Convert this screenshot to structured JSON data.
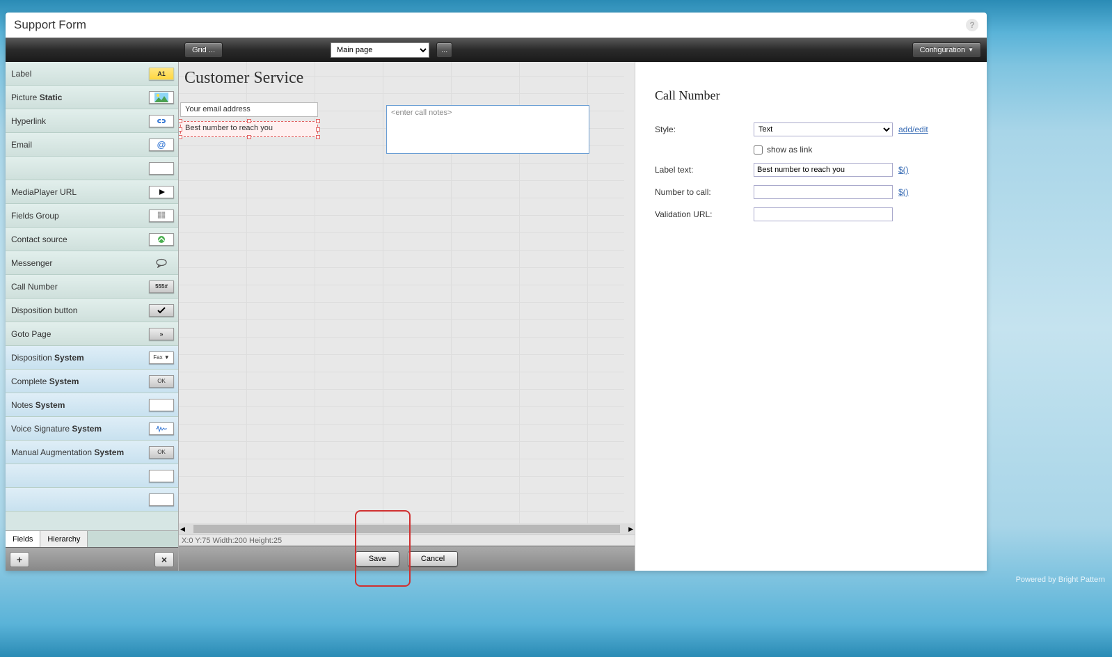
{
  "header": {
    "title": "Support Form"
  },
  "toolbar": {
    "grid_label": "Grid ...",
    "page_selected": "Main page",
    "ellipsis_label": "...",
    "config_label": "Configuration"
  },
  "palette": {
    "items": [
      {
        "label": "Label",
        "chip": "A1",
        "style": "default"
      },
      {
        "label_prefix": "Picture ",
        "label_bold": "Static",
        "chip": "img",
        "style": "default"
      },
      {
        "label": "Hyperlink",
        "chip": "link",
        "style": "default"
      },
      {
        "label": "Email",
        "chip": "@",
        "style": "default"
      },
      {
        "label": "",
        "chip": "",
        "style": "empty"
      },
      {
        "label": "MediaPlayer URL",
        "chip": "play",
        "style": "default"
      },
      {
        "label": "Fields Group",
        "chip": "grid",
        "style": "default"
      },
      {
        "label": "Contact source",
        "chip": "contact",
        "style": "default"
      },
      {
        "label": "Messenger",
        "chip": "chat",
        "style": "default"
      },
      {
        "label": "Call Number",
        "chip": "555#",
        "style": "default"
      },
      {
        "label": "Disposition button",
        "chip": "check",
        "style": "default"
      },
      {
        "label": "Goto Page",
        "chip": ">>",
        "style": "default"
      },
      {
        "label_prefix": "Disposition ",
        "label_bold": "System",
        "chip": "Fax ▼",
        "style": "blue"
      },
      {
        "label_prefix": "Complete ",
        "label_bold": "System",
        "chip": "OK",
        "style": "blue"
      },
      {
        "label_prefix": "Notes ",
        "label_bold": "System",
        "chip": "",
        "style": "blue"
      },
      {
        "label_prefix": "Voice Signature ",
        "label_bold": "System",
        "chip": "wave",
        "style": "blue"
      },
      {
        "label_prefix": "Manual Augmentation ",
        "label_bold": "System",
        "chip": "OK",
        "style": "blue"
      },
      {
        "label": "",
        "chip": "",
        "style": "blue"
      },
      {
        "label": "",
        "chip": "",
        "style": "blue"
      }
    ],
    "tabs": {
      "fields": "Fields",
      "hierarchy": "Hierarchy"
    }
  },
  "canvas": {
    "title": "Customer Service",
    "email_field_label": "Your email address",
    "callnum_field_label": "Best number to reach you",
    "notes_placeholder": "<enter call notes>",
    "status": "X:0 Y:75 Width:200 Height:25"
  },
  "actions": {
    "save": "Save",
    "cancel": "Cancel"
  },
  "props": {
    "title": "Call Number",
    "rows": {
      "style_label": "Style:",
      "style_value": "Text",
      "addedit_link": "add/edit",
      "showlink_label": "show as link",
      "showlink_checked": false,
      "labeltext_label": "Label text:",
      "labeltext_value": "Best number to reach you",
      "labeltext_link": "$()",
      "number_label": "Number to call:",
      "number_value": "",
      "number_link": "$()",
      "validation_label": "Validation URL:",
      "validation_value": ""
    }
  },
  "footer": {
    "brand": "Powered by Bright Pattern"
  }
}
